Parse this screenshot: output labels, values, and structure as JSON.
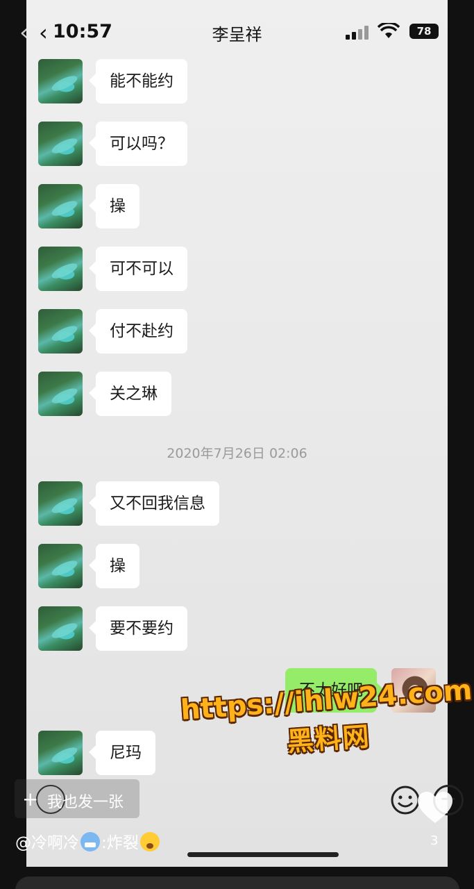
{
  "status_bar": {
    "time": "10:57",
    "battery": "78"
  },
  "nav": {
    "title": "李呈祥"
  },
  "messages": [
    {
      "text": "能不能约"
    },
    {
      "text": "可以吗？"
    },
    {
      "text": "操"
    },
    {
      "text": "可不可以"
    },
    {
      "text": "付不赴约"
    },
    {
      "text": "关之琳"
    },
    {
      "text": "又不回我信息"
    },
    {
      "text": "操"
    },
    {
      "text": "要不要约"
    },
    {
      "text": "尼玛"
    }
  ],
  "timestamp": "2020年7月26日 02:06",
  "outgoing_message": "不太好吧",
  "overlay": {
    "post_plus": "+",
    "post_label": "我也发一张",
    "like_count": "3",
    "comment_user": "@冷啊冷",
    "comment_sep": ":",
    "comment_text": "炸裂"
  },
  "watermark": {
    "url": "https://ihlw24.com",
    "name": "黑料网"
  },
  "colors": {
    "outgoing_bubble": "#95ec69",
    "incoming_bubble": "#ffffff",
    "watermark": "#ffb21a"
  },
  "icons": [
    "back-arrow-icon",
    "signal-icon",
    "wifi-icon",
    "battery-icon",
    "emoji-icon",
    "plus-icon",
    "heart-icon"
  ]
}
